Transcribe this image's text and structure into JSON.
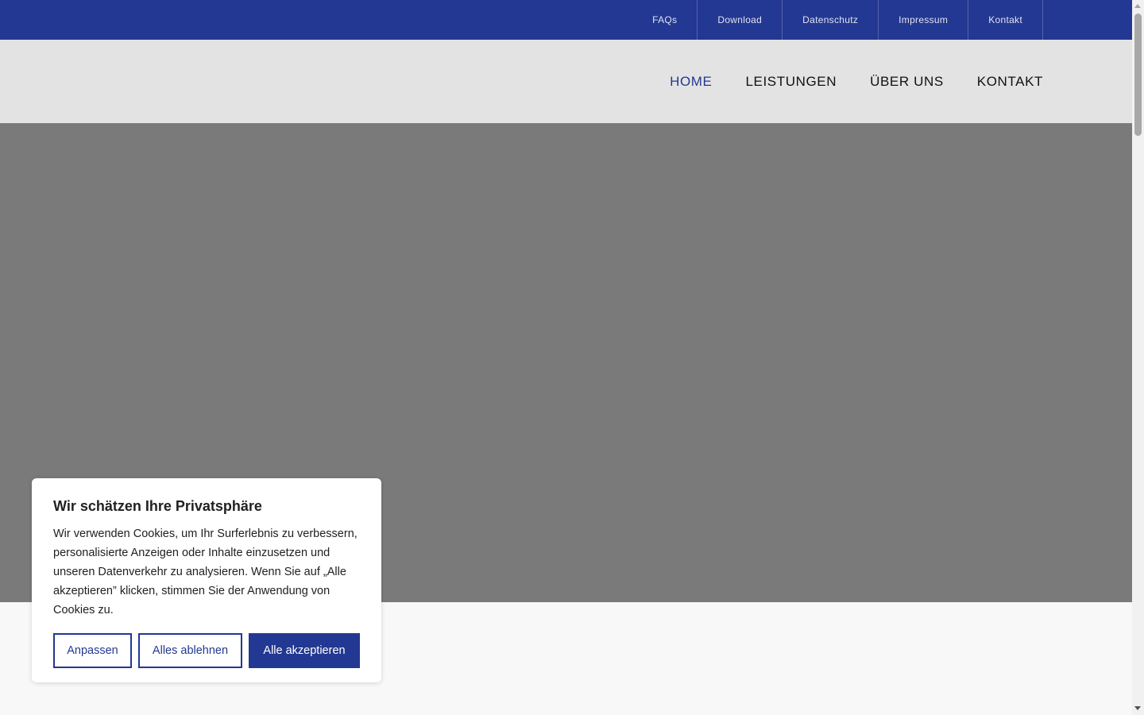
{
  "topbar": {
    "links": [
      "FAQs",
      "Download",
      "Datenschutz",
      "Impressum",
      "Kontakt"
    ]
  },
  "mainnav": {
    "items": [
      "HOME",
      "LEISTUNGEN",
      "ÜBER UNS",
      "KONTAKT"
    ],
    "active": "HOME"
  },
  "cookie_banner": {
    "title": "Wir schätzen Ihre Privatsphäre",
    "body": "Wir verwenden Cookies, um Ihr Surferlebnis zu verbessern, personalisierte Anzeigen oder Inhalte einzusetzen und unseren Datenverkehr zu analysieren. Wenn Sie auf „Alle akzeptieren” klicken, stimmen Sie der Anwendung von Cookies zu.",
    "customize_label": "Anpassen",
    "reject_label": "Alles ablehnen",
    "accept_label": "Alle akzeptieren"
  },
  "colors": {
    "brand_blue": "#233892",
    "nav_background": "#e3e3e3",
    "hero_placeholder": "#7a7a7a"
  }
}
